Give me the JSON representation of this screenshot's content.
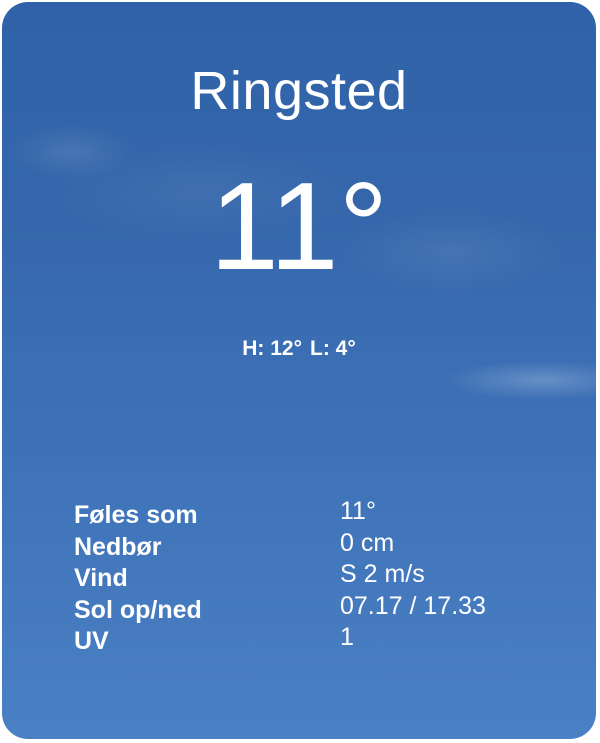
{
  "city": "Ringsted",
  "temperature": "11°",
  "hi_lo": {
    "high": "H: 12°",
    "low": "L: 4°"
  },
  "details": [
    {
      "label": "Føles som",
      "value": "11°"
    },
    {
      "label": "Nedbør",
      "value": "0 cm"
    },
    {
      "label": "Vind",
      "value": "S 2 m/s"
    },
    {
      "label": "Sol op/ned",
      "value": "07.17 / 17.33"
    },
    {
      "label": "UV",
      "value": "1"
    }
  ],
  "colors": {
    "sky_top": "#2f62a8",
    "sky_bottom": "#4a80c4",
    "text": "#ffffff"
  }
}
